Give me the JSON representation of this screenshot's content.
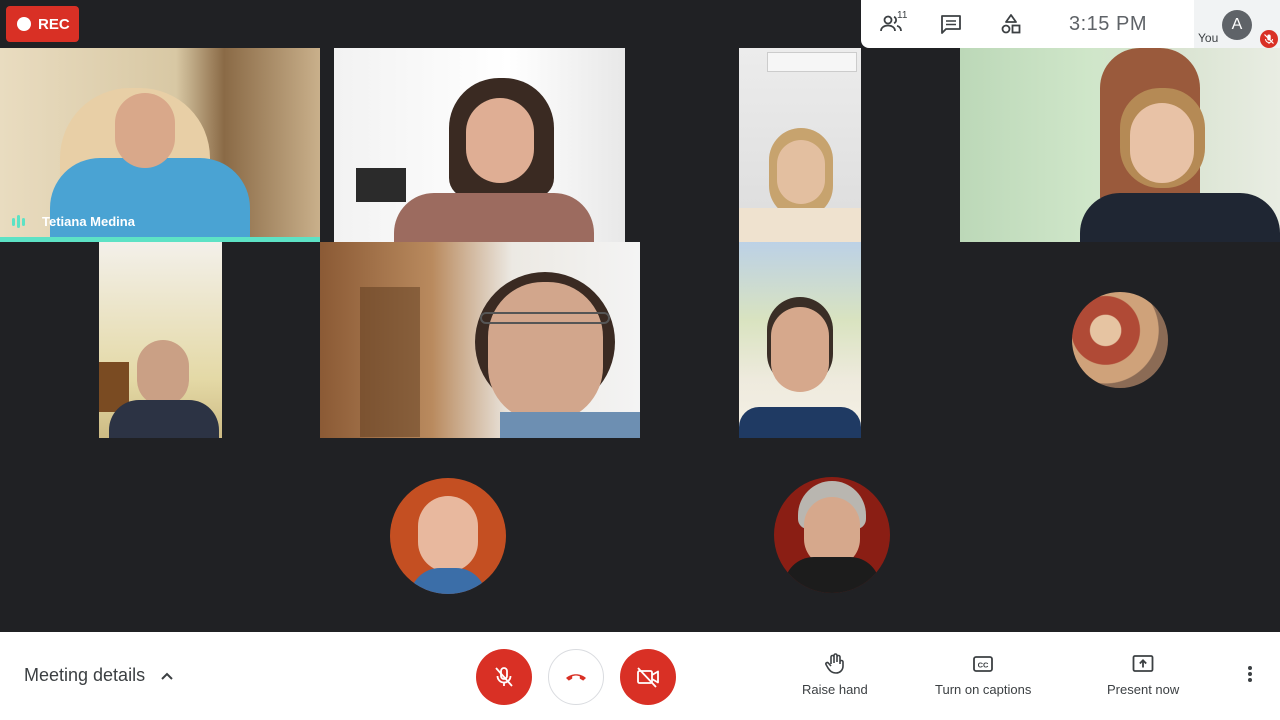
{
  "recording": {
    "label": "REC"
  },
  "topbar": {
    "participants_count": "11",
    "time": "3:15 PM",
    "self_label": "You",
    "self_initial": "A"
  },
  "tiles": {
    "active_speaker_name": "Tetiana Medina"
  },
  "bottombar": {
    "meeting_details_label": "Meeting details",
    "raise_hand_label": "Raise hand",
    "captions_label": "Turn on captions",
    "present_label": "Present now"
  },
  "colors": {
    "accent_red": "#d93025",
    "speaking_indicator": "#5de2c5",
    "background": "#202124"
  }
}
